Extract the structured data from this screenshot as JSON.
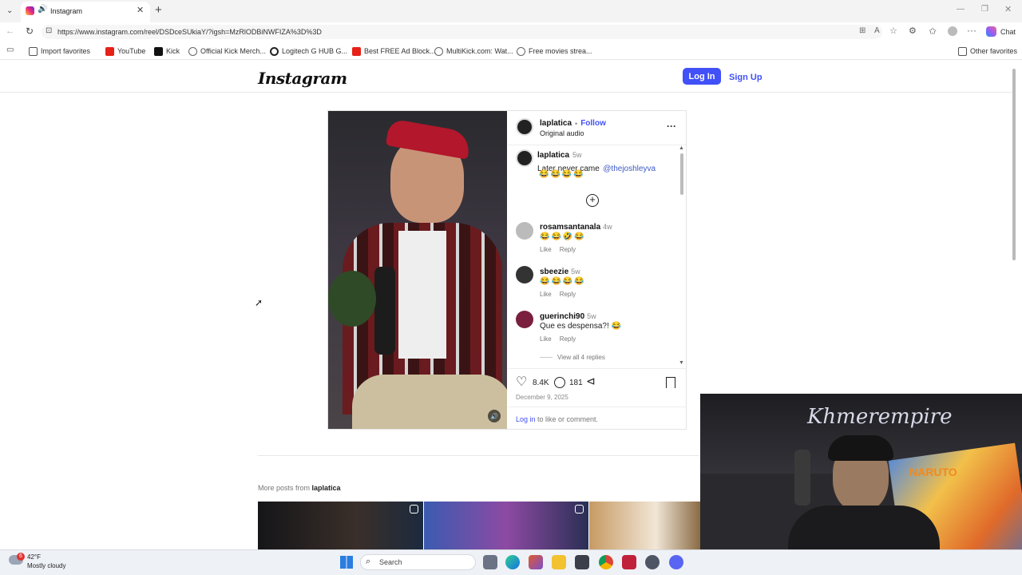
{
  "browser": {
    "tab_title": "Instagram",
    "url": "https://www.instagram.com/reel/DSDceSUkiaY/?igsh=MzRlODBiNWFIZA%3D%3D",
    "chat_label": "Chat",
    "favorites": [
      {
        "label": "Import favorites",
        "icon": "import-icon"
      },
      {
        "label": "YouTube",
        "icon": "youtube-icon"
      },
      {
        "label": "Kick",
        "icon": "kick-icon"
      },
      {
        "label": "Official Kick Merch...",
        "icon": "globe-icon"
      },
      {
        "label": "Logitech G HUB G...",
        "icon": "logitech-icon"
      },
      {
        "label": "Best FREE Ad Block...",
        "icon": "youtube-icon"
      },
      {
        "label": "MultiKick.com: Wat...",
        "icon": "globe-icon"
      },
      {
        "label": "Free movies strea...",
        "icon": "globe-icon"
      }
    ],
    "other_favorites": "Other favorites"
  },
  "header": {
    "logo": "Instagram",
    "login": "Log In",
    "signup": "Sign Up"
  },
  "post": {
    "author": "laplatica",
    "follow": "Follow",
    "dot": "•",
    "audio": "Original audio",
    "caption_user": "laplatica",
    "caption_time": "5w",
    "caption_text": "Later never came",
    "caption_mention": "@thejoshleyva",
    "caption_emoji": "😂😂😂😂",
    "comments": [
      {
        "user": "rosamsantanala",
        "time": "4w",
        "text": "😂😂🤣😂",
        "like": "Like",
        "reply": "Reply"
      },
      {
        "user": "sbeezie",
        "time": "5w",
        "text": "😂😂😂😂",
        "like": "Like",
        "reply": "Reply"
      },
      {
        "user": "guerinchi90",
        "time": "5w",
        "text": "Que es despensa?! 😂",
        "like": "Like",
        "reply": "Reply"
      }
    ],
    "view_replies": "View all 4 replies",
    "likes": "8.4K",
    "comment_count": "181",
    "date": "December 9, 2025",
    "login_link": "Log in",
    "login_rest": " to like or comment."
  },
  "more_posts": {
    "prefix": "More posts from ",
    "user": "laplatica"
  },
  "webcam": {
    "banner": "Khmerempire",
    "poster": "NARUTO"
  },
  "taskbar": {
    "temp": "42°F",
    "weather": "Mostly cloudy",
    "badge": "6",
    "search": "Search"
  },
  "colors": {
    "accent": "#4150f7",
    "follow": "#4150f7",
    "mention": "#3d5ac7"
  }
}
